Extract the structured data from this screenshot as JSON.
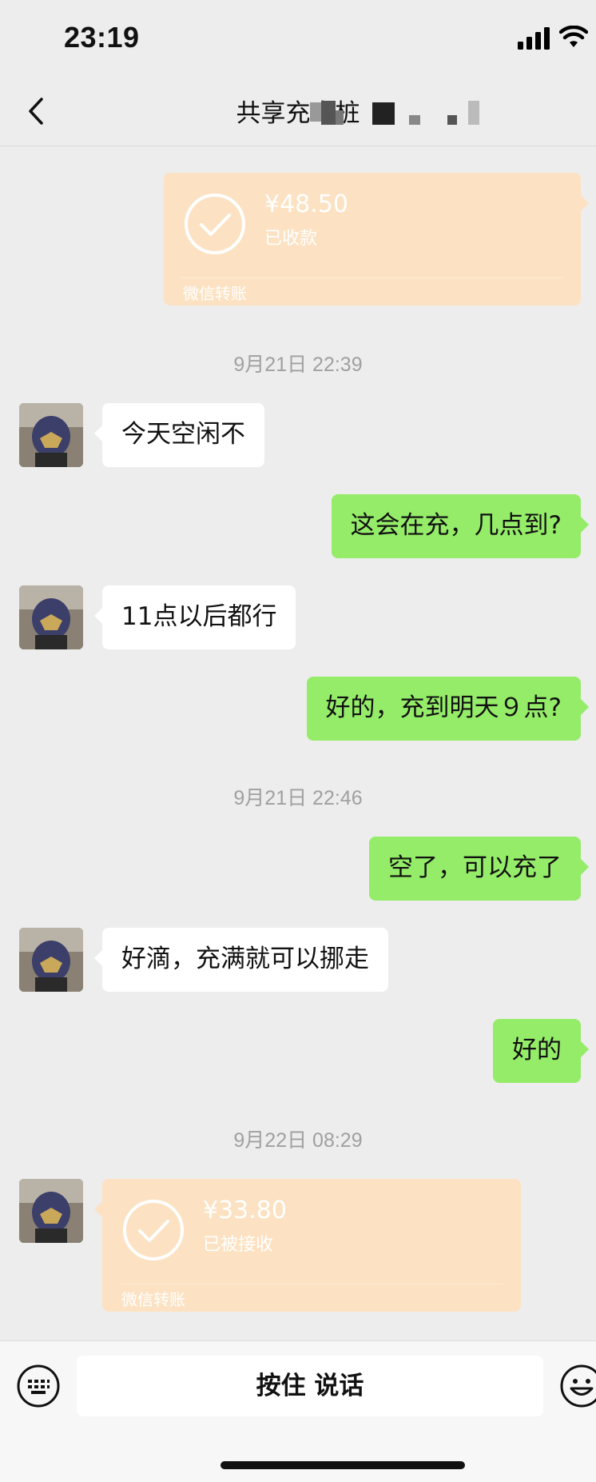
{
  "status_bar": {
    "time": "23:19",
    "signal_icon": "signal-bars-icon",
    "wifi_icon": "wifi-icon"
  },
  "header": {
    "title": "共享充电桩"
  },
  "messages": {
    "transfer_top": {
      "amount": "¥48.50",
      "status": "已收款",
      "label": "微信转账"
    },
    "stamp1": "9月21日 22:39",
    "m1": "今天空闲不",
    "m2": "这会在充，几点到?",
    "m3": "11点以后都行",
    "m4": "好的，充到明天９点?",
    "stamp2": "9月21日 22:46",
    "m5": "空了，可以充了",
    "m6": "好滴，充满就可以挪走",
    "m7": "好的",
    "stamp3": "9月22日 08:29",
    "transfer_bottom": {
      "amount": "¥33.80",
      "status": "已被接收",
      "label": "微信转账"
    }
  },
  "input_bar": {
    "voice_button": "按住 说话"
  },
  "colors": {
    "background": "#ededed",
    "outgoing_bubble": "#95ec69",
    "incoming_bubble": "#ffffff",
    "transfer_card": "#fce2c2"
  }
}
